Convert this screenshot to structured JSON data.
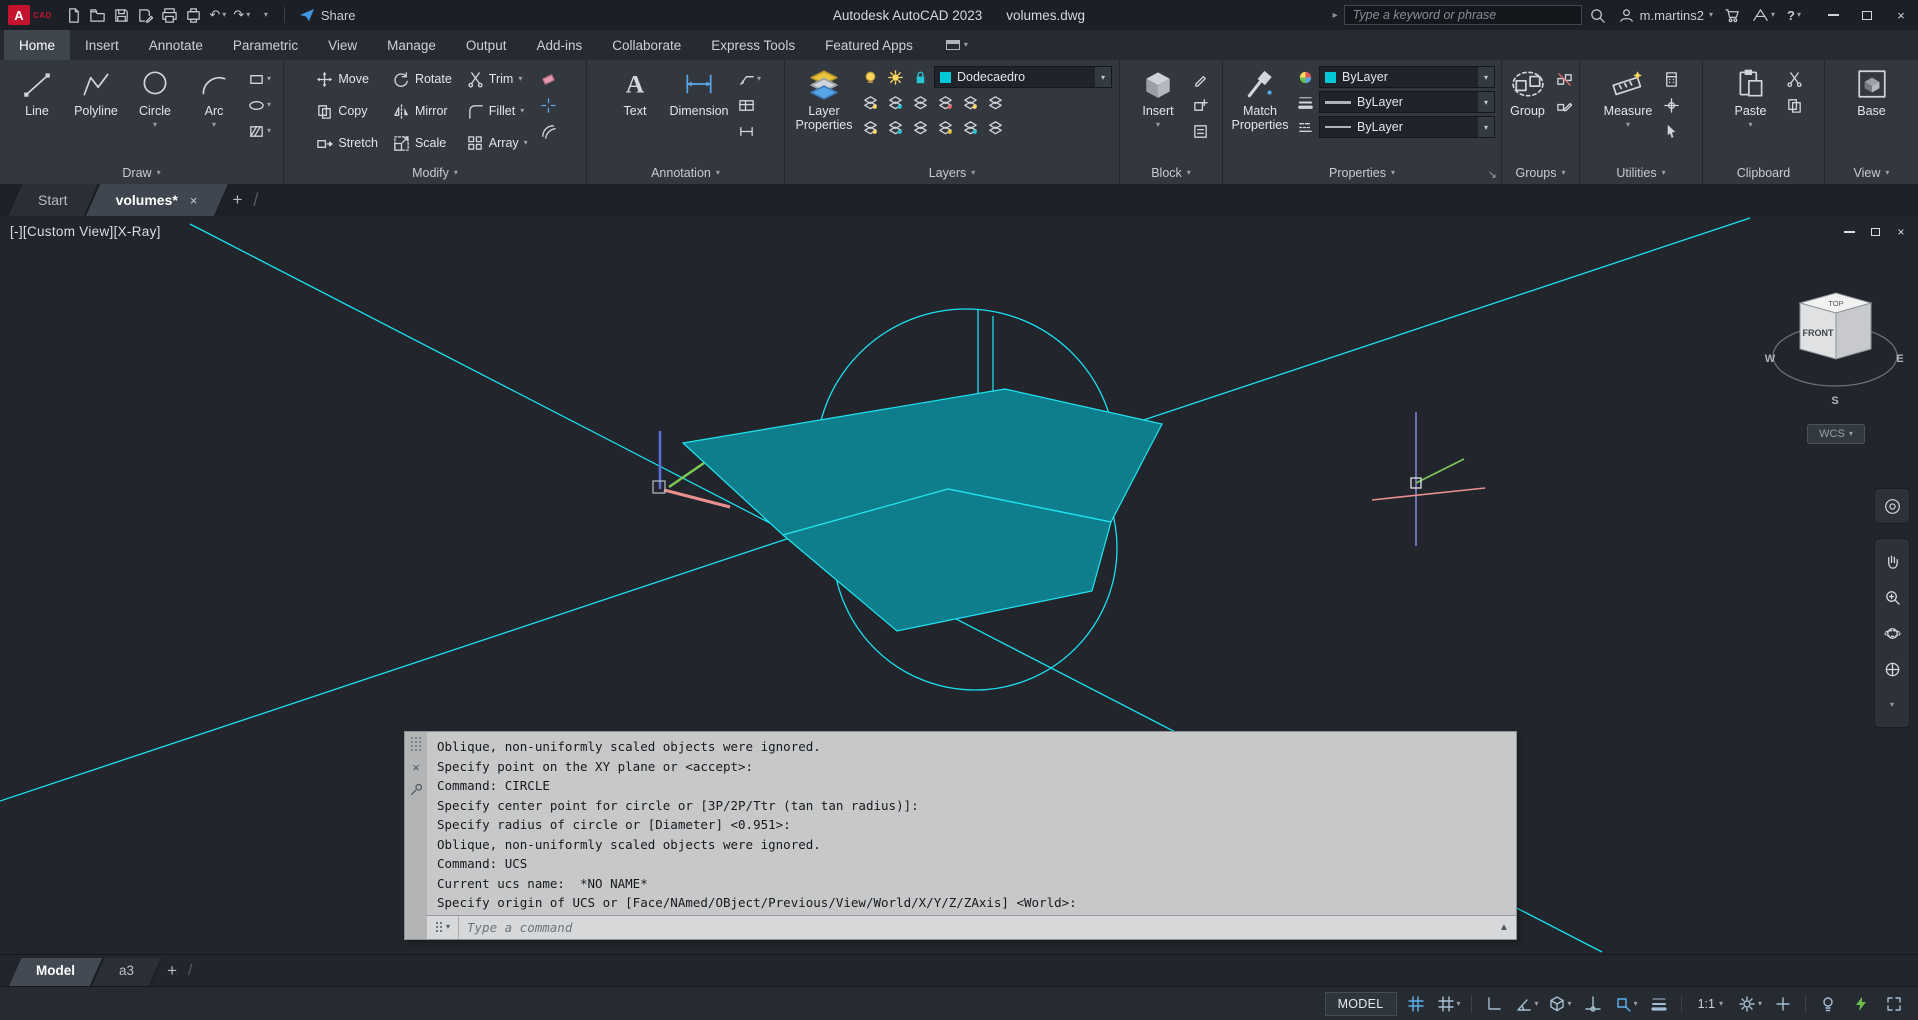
{
  "titlebar": {
    "logo_letter": "A",
    "logo_sub": "CAD",
    "share": "Share",
    "app_title": "Autodesk AutoCAD 2023",
    "doc_title": "volumes.dwg",
    "search_placeholder": "Type a keyword or phrase",
    "user": "m.martins2"
  },
  "ribbon": {
    "tabs": [
      {
        "label": "Home"
      },
      {
        "label": "Insert"
      },
      {
        "label": "Annotate"
      },
      {
        "label": "Parametric"
      },
      {
        "label": "View"
      },
      {
        "label": "Manage"
      },
      {
        "label": "Output"
      },
      {
        "label": "Add-ins"
      },
      {
        "label": "Collaborate"
      },
      {
        "label": "Express Tools"
      },
      {
        "label": "Featured Apps"
      }
    ],
    "draw": {
      "label": "Draw",
      "line": "Line",
      "polyline": "Polyline",
      "circle": "Circle",
      "arc": "Arc"
    },
    "modify": {
      "label": "Modify",
      "move": "Move",
      "copy": "Copy",
      "stretch": "Stretch",
      "rotate": "Rotate",
      "mirror": "Mirror",
      "scale": "Scale",
      "trim": "Trim",
      "fillet": "Fillet",
      "array": "Array"
    },
    "annotation": {
      "label": "Annotation",
      "text": "Text",
      "dimension": "Dimension"
    },
    "layers": {
      "label": "Layers",
      "big": "Layer Properties",
      "current": "Dodecaedro"
    },
    "block": {
      "label": "Block",
      "big": "Insert"
    },
    "properties": {
      "label": "Properties",
      "big": "Match Properties",
      "color": "ByLayer",
      "lineweight": "ByLayer",
      "linetype": "ByLayer"
    },
    "groups": {
      "label": "Groups",
      "big": "Group"
    },
    "utilities": {
      "label": "Utilities",
      "big": "Measure"
    },
    "clipboard": {
      "label": "Clipboard",
      "big": "Paste"
    },
    "view": {
      "label": "View",
      "big": "Base"
    }
  },
  "file_tabs": {
    "start": "Start",
    "current": "volumes*"
  },
  "viewport": {
    "controls": "[-][Custom View][X-Ray]",
    "wcs": "WCS"
  },
  "viewcube": {
    "top": "TOP",
    "front": "FRONT",
    "west": "W",
    "south": "S",
    "east": "E"
  },
  "command": {
    "lines": [
      "Oblique, non-uniformly scaled objects were ignored.",
      "Specify point on the XY plane or <accept>:",
      "Command: CIRCLE",
      "Specify center point for circle or [3P/2P/Ttr (tan tan radius)]:",
      "Specify radius of circle or [Diameter] <0.951>:",
      "Oblique, non-uniformly scaled objects were ignored.",
      "Command: UCS",
      "Current ucs name:  *NO NAME*",
      "Specify origin of UCS or [Face/NAmed/OBject/Previous/View/World/X/Y/Z/ZAxis] <World>:"
    ],
    "placeholder": "Type a command"
  },
  "layout_tabs": {
    "model": "Model",
    "a3": "a3"
  },
  "statusbar": {
    "model": "MODEL",
    "scale": "1:1"
  },
  "colors": {
    "accent_cyan": "#00c8d7",
    "teal_fill": "#0f7e8c",
    "line_cyan": "#1ae0ef"
  },
  "icons": {
    "caret": "▾",
    "close": "×",
    "slash": "/",
    "plus": "+",
    "undo": "↶",
    "redo": "↷",
    "arrow": "▸",
    "question": "?",
    "scroll_up": "▲",
    "launcher": "↘"
  }
}
